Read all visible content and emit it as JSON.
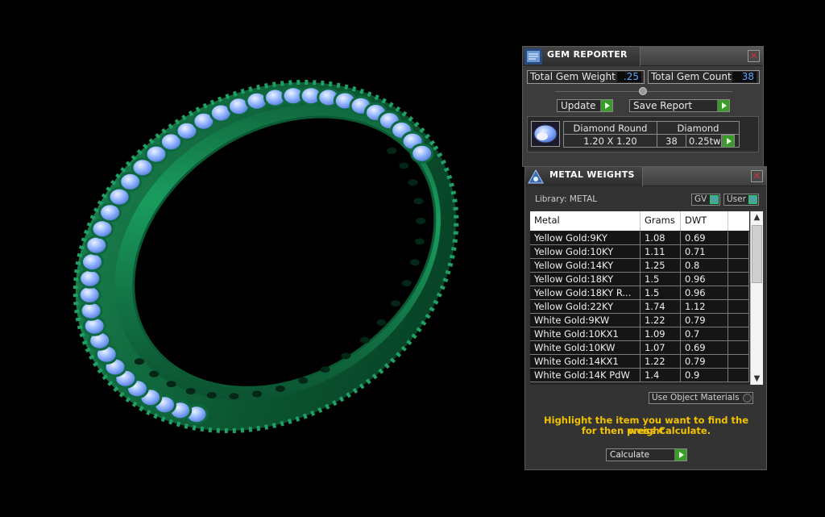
{
  "gem_reporter": {
    "title": "GEM REPORTER",
    "close": "✕",
    "total_gem_weight_label": "Total Gem Weight",
    "total_gem_weight": ".25",
    "total_gem_count_label": "Total Gem Count",
    "total_gem_count": "38",
    "update_label": "Update",
    "save_report_label": "Save Report",
    "gem": {
      "shape": "Diamond Round",
      "material": "Diamond",
      "size": "1.20 X 1.20",
      "count": "38",
      "weight": "0.25tw"
    }
  },
  "metal_weights": {
    "title": "METAL WEIGHTS",
    "close": "✕",
    "library_label": "Library: METAL",
    "gv_label": "GV",
    "user_label": "User",
    "columns": [
      "Metal",
      "Grams",
      "DWT"
    ],
    "rows": [
      {
        "metal": "Yellow Gold:9KY",
        "grams": "1.08",
        "dwt": "0.69"
      },
      {
        "metal": "Yellow Gold:10KY",
        "grams": "1.11",
        "dwt": "0.71"
      },
      {
        "metal": "Yellow Gold:14KY",
        "grams": "1.25",
        "dwt": "0.8"
      },
      {
        "metal": "Yellow Gold:18KY",
        "grams": "1.5",
        "dwt": "0.96"
      },
      {
        "metal": "Yellow Gold:18KY R...",
        "grams": "1.5",
        "dwt": "0.96"
      },
      {
        "metal": "Yellow Gold:22KY",
        "grams": "1.74",
        "dwt": "1.12"
      },
      {
        "metal": "White Gold:9KW",
        "grams": "1.22",
        "dwt": "0.79"
      },
      {
        "metal": "White Gold:10KX1",
        "grams": "1.09",
        "dwt": "0.7"
      },
      {
        "metal": "White Gold:10KW",
        "grams": "1.07",
        "dwt": "0.69"
      },
      {
        "metal": "White Gold:14KX1",
        "grams": "1.22",
        "dwt": "0.79"
      },
      {
        "metal": "White Gold:14K PdW",
        "grams": "1.4",
        "dwt": "0.9"
      }
    ],
    "use_object_materials_label": "Use Object Materials",
    "hint_line1": "Highlight the item you want to find the weight",
    "hint_line2": "for then press Calculate.",
    "calculate_label": "Calculate"
  },
  "colors": {
    "ring_metal": "#0f6a3e",
    "gems": "#8fb2ff",
    "accent_green": "#3a9a2a",
    "hint_yellow": "#f2c200"
  }
}
